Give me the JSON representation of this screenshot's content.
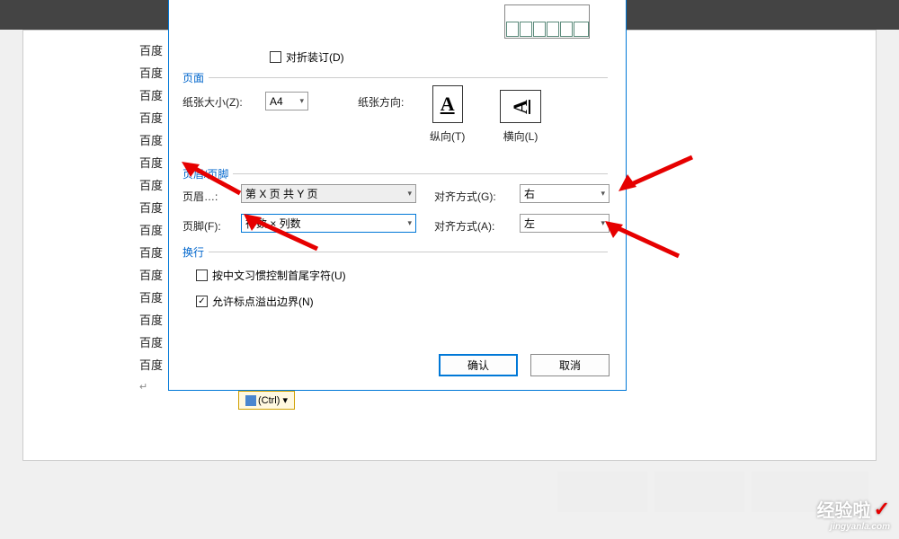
{
  "sidebar_text": "百度",
  "sidebar_count": 15,
  "fold_binding": {
    "label": "对折装订(D)",
    "checked": false
  },
  "section_page": "页面",
  "paper_size": {
    "label": "纸张大小(Z):",
    "value": "A4"
  },
  "paper_orient_label": "纸张方向:",
  "orient": {
    "portrait": {
      "label": "纵向(T)",
      "letter": "A"
    },
    "landscape": {
      "label": "横向(L)",
      "letter": "A"
    }
  },
  "section_header_footer": "页眉/页脚",
  "header": {
    "label": "页眉…:",
    "value": "第 X 页 共 Y 页"
  },
  "header_align": {
    "label": "对齐方式(G):",
    "value": "右"
  },
  "footer": {
    "label": "页脚(F):",
    "value": "行数 × 列数"
  },
  "footer_align": {
    "label": "对齐方式(A):",
    "value": "左"
  },
  "section_wrap": "换行",
  "wrap_cjk": {
    "label": "按中文习惯控制首尾字符(U)",
    "checked": false
  },
  "wrap_punct": {
    "label": "允许标点溢出边界(N)",
    "checked": true
  },
  "buttons": {
    "ok": "确认",
    "cancel": "取消"
  },
  "ctrl_btn": "(Ctrl) ▾",
  "watermark": {
    "main": "经验啦",
    "sub": "jingyanla.com"
  },
  "colors": {
    "accent": "#0078d7",
    "link": "#0066cc",
    "arrow": "#e60000"
  }
}
